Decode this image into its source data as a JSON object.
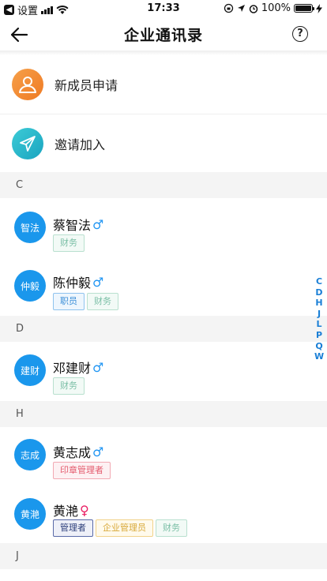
{
  "status": {
    "back_app": "设置",
    "time": "17:33",
    "battery": "100%"
  },
  "nav": {
    "title": "企业通讯录",
    "help": "?"
  },
  "actions": [
    {
      "label": "新成员申请",
      "icon": "person-add-icon",
      "color": "#f28a2d"
    },
    {
      "label": "邀请加入",
      "icon": "paper-plane-icon",
      "color": "#25b9c9"
    }
  ],
  "sections": [
    {
      "letter": "C",
      "contacts": [
        {
          "avatar": "智法",
          "name": "蔡智法",
          "gender": "♂",
          "tags": [
            "财务"
          ]
        },
        {
          "avatar": "仲毅",
          "name": "陈仲毅",
          "gender": "♂",
          "tags": [
            "职员",
            "财务"
          ]
        }
      ]
    },
    {
      "letter": "D",
      "contacts": [
        {
          "avatar": "建财",
          "name": "邓建财",
          "gender": "♂",
          "tags": [
            "财务"
          ]
        }
      ]
    },
    {
      "letter": "H",
      "contacts": [
        {
          "avatar": "志成",
          "name": "黄志成",
          "gender": "♂",
          "tags": [
            "印章管理者"
          ]
        },
        {
          "avatar": "黄滟",
          "name": "黄滟",
          "gender": "♀",
          "tags": [
            "管理者",
            "企业管理员",
            "财务"
          ]
        }
      ]
    },
    {
      "letter": "J",
      "contacts": []
    }
  ],
  "index": [
    "C",
    "D",
    "H",
    "J",
    "L",
    "P",
    "Q",
    "W"
  ],
  "colors": {
    "accent": "#1a97ec"
  }
}
